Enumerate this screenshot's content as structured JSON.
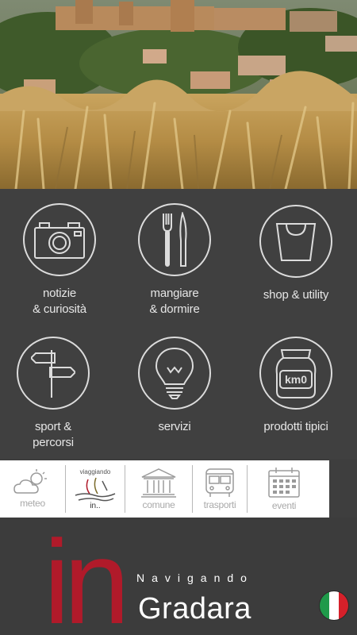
{
  "menu": {
    "items": [
      {
        "label": "notizie\n& curiosità",
        "icon": "camera-icon"
      },
      {
        "label": "mangiare\n& dormire",
        "icon": "fork-knife-icon"
      },
      {
        "label": "shop & utility",
        "icon": "shopping-bag-icon"
      },
      {
        "label": "sport &\npercorsi",
        "icon": "signpost-icon"
      },
      {
        "label": "servizi",
        "icon": "lightbulb-icon"
      },
      {
        "label": "prodotti tipici",
        "icon": "jar-icon"
      }
    ]
  },
  "jar_text": "km0",
  "toolbar": {
    "items": [
      {
        "label": "meteo",
        "icon": "weather-icon"
      },
      {
        "label": "",
        "icon": "viaggiando-in-logo",
        "caption_top": "viaggiando",
        "caption_bottom": "in.."
      },
      {
        "label": "comune",
        "icon": "town-hall-icon"
      },
      {
        "label": "trasporti",
        "icon": "bus-icon"
      },
      {
        "label": "eventi",
        "icon": "calendar-icon"
      }
    ]
  },
  "brand": {
    "logo": "in",
    "subtitle": "Navigando",
    "town": "Gradara"
  },
  "language": {
    "flag": "italian-flag-icon",
    "colors": [
      "#1f9a4a",
      "#ffffff",
      "#d6202a"
    ]
  },
  "colors": {
    "background": "#404040",
    "brand_red": "#b01a2a",
    "icon_stroke": "#dcdcdc"
  }
}
